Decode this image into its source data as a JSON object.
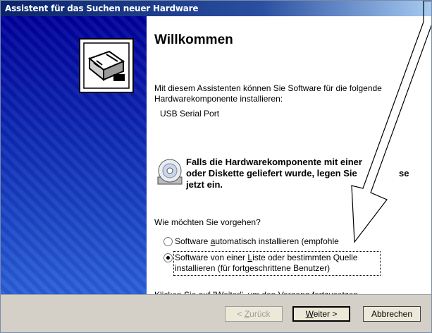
{
  "window": {
    "title": "Assistent für das Suchen neuer Hardware"
  },
  "content": {
    "heading": "Willkommen",
    "intro_line1": "Mit diesem Assistenten können Sie Software für die folgende",
    "intro_line2": "Hardwarekomponente installieren:",
    "device_name": "USB Serial Port",
    "disk_note_line1": "Falls die Hardwarekomponente mit einer",
    "disk_note_line2": "oder Diskette geliefert wurde, legen Sie",
    "disk_note_partial": "se",
    "disk_note_line3": "jetzt ein.",
    "question": "Wie möchten Sie vorgehen?",
    "options": [
      {
        "label_pre": "Software ",
        "label_accel": "a",
        "label_post": "utomatisch installieren (empfohle",
        "selected": false
      },
      {
        "label_pre": "Software von einer ",
        "label_accel": "L",
        "label_post": "iste oder bestimmten Quelle",
        "label_line2": "installieren (für fortgeschrittene Benutzer)",
        "selected": true
      }
    ],
    "continue_hint": "Klicken Sie auf \"Weiter\", um den Vorgang fortzusetzen."
  },
  "buttons": {
    "back_pre": "< ",
    "back_accel": "Z",
    "back_post": "urück",
    "next_accel": "W",
    "next_post": "eiter >",
    "cancel": "Abbrechen"
  },
  "colors": {
    "sidebar_top": "#00009a",
    "sidebar_bottom": "#2a5fd8",
    "title_bar": "#0a246a",
    "button_bar": "#d4d0c8"
  },
  "icons": {
    "hardware": "hardware-card-icon",
    "disk": "cd-disk-icon"
  }
}
